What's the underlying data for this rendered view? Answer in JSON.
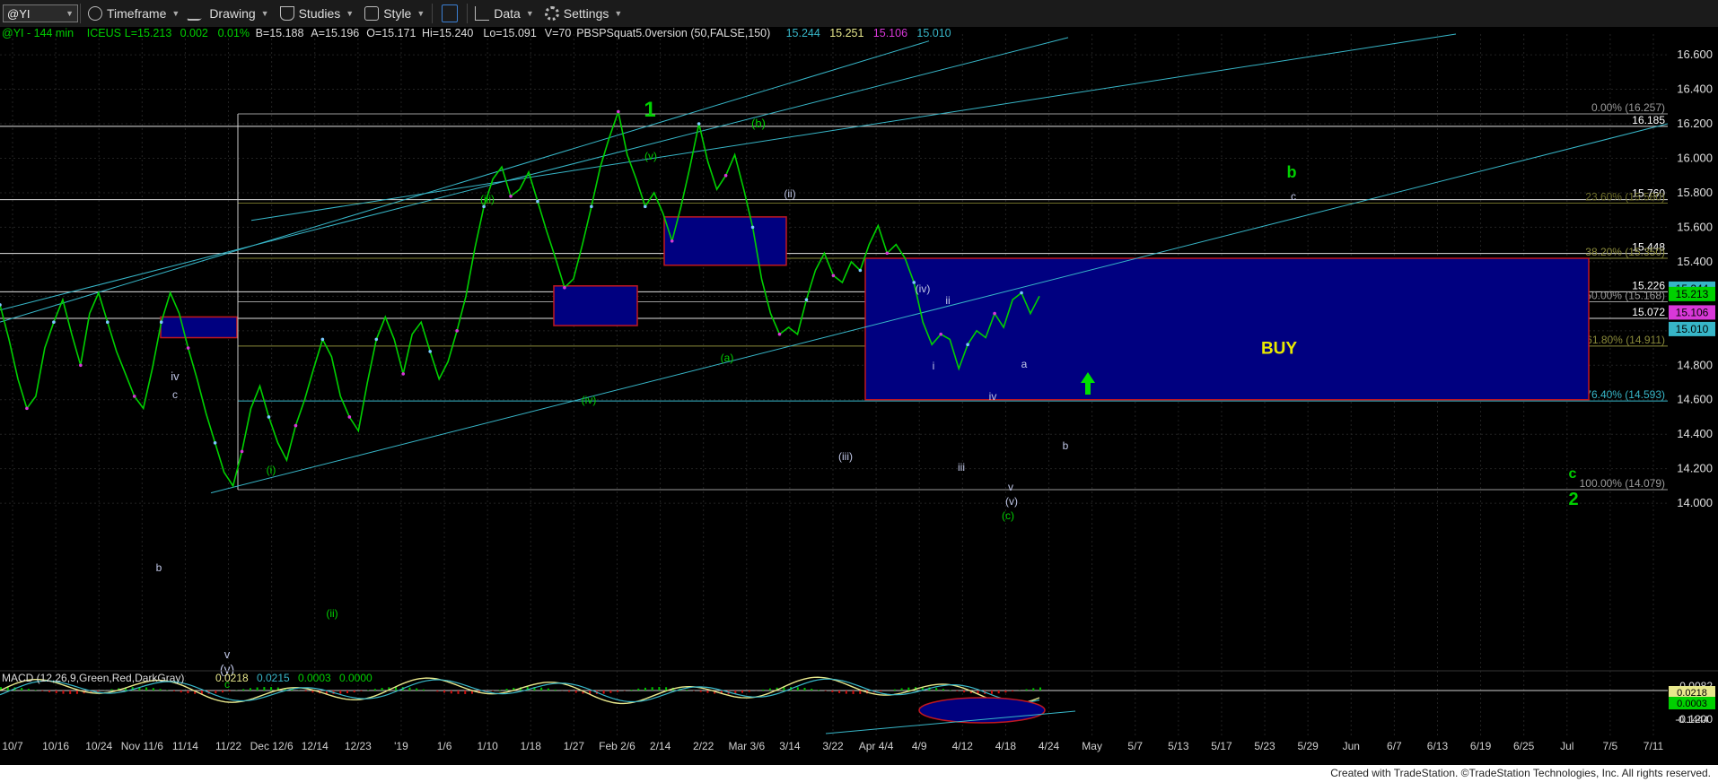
{
  "toolbar": {
    "symbol": "@YI",
    "items": [
      "Timeframe",
      "Drawing",
      "Studies",
      "Style",
      "Data",
      "Settings"
    ]
  },
  "header": {
    "parts": [
      {
        "text": "@YI - 144 min",
        "color": "#00d000"
      },
      {
        "text": "ICEUS",
        "color": "#00d000"
      },
      {
        "text": "L=15.213",
        "color": "#00d000"
      },
      {
        "text": "0.002",
        "color": "#00d000"
      },
      {
        "text": "0.01%",
        "color": "#00d000"
      },
      {
        "text": "B=15.188",
        "color": "#dddddd"
      },
      {
        "text": "A=15.196",
        "color": "#dddddd"
      },
      {
        "text": "O=15.171",
        "color": "#dddddd"
      },
      {
        "text": "Hi=15.240",
        "color": "#dddddd"
      },
      {
        "text": "Lo=15.091",
        "color": "#dddddd"
      },
      {
        "text": "V=70",
        "color": "#dddddd"
      },
      {
        "text": "PBSPSquat5.0version (50,FALSE,150)",
        "color": "#dddddd"
      },
      {
        "text": "15.244",
        "color": "#37b6c8"
      },
      {
        "text": "15.251",
        "color": "#e8e88c"
      },
      {
        "text": "15.106",
        "color": "#d838d8"
      },
      {
        "text": "15.010",
        "color": "#37b6c8"
      }
    ]
  },
  "macd": {
    "label": "MACD (12,26,9,Green,Red,DarkGray)",
    "values": [
      {
        "text": "0.0218",
        "color": "#e8e88c"
      },
      {
        "text": "0.0215",
        "color": "#37b6c8"
      },
      {
        "text": "0.0003",
        "color": "#00d000"
      },
      {
        "text": "0.0000",
        "color": "#00d000"
      }
    ],
    "axis": [
      {
        "y": -0.0082,
        "label": "-0.0082"
      },
      {
        "y": -0.12,
        "label": "-0.1200"
      }
    ],
    "tags": [
      {
        "y": -0.1444,
        "label": "-0.1444",
        "bg": "#000000",
        "fg": "#dddddd"
      },
      {
        "y": 0.0218,
        "label": "0.0218",
        "bg": "#e8e88c",
        "fg": "#000000"
      },
      {
        "y": 0.0003,
        "label": "0.0003",
        "bg": "#00d000",
        "fg": "#000000"
      }
    ]
  },
  "chart_data": {
    "type": "line",
    "ylim": [
      13.85,
      16.72
    ],
    "yticks": [
      14.0,
      14.2,
      14.4,
      14.6,
      14.8,
      15.0,
      15.2,
      15.4,
      15.6,
      15.8,
      16.0,
      16.2,
      16.4,
      16.6
    ],
    "xticks": [
      "10/7",
      "10/16",
      "10/24",
      "Nov 11/6",
      "11/14",
      "11/22",
      "Dec 12/6",
      "12/14",
      "12/23",
      "'19",
      "1/6",
      "1/10",
      "1/18",
      "1/27",
      "Feb 2/6",
      "2/14",
      "2/22",
      "Mar 3/6",
      "3/14",
      "3/22",
      "Apr 4/4",
      "4/9",
      "4/12",
      "4/18",
      "4/24",
      "May",
      "5/7",
      "5/13",
      "5/17",
      "5/23",
      "5/29",
      "Jun",
      "6/7",
      "6/13",
      "6/19",
      "6/25",
      "Jul",
      "7/5",
      "7/11"
    ],
    "price_path": [
      15.15,
      14.95,
      14.72,
      14.55,
      14.62,
      14.9,
      15.05,
      15.18,
      14.98,
      14.8,
      15.1,
      15.22,
      15.05,
      14.88,
      14.75,
      14.62,
      14.55,
      14.78,
      15.05,
      15.22,
      15.1,
      14.9,
      14.72,
      14.52,
      14.35,
      14.18,
      14.1,
      14.3,
      14.55,
      14.68,
      14.5,
      14.35,
      14.25,
      14.45,
      14.6,
      14.78,
      14.95,
      14.85,
      14.62,
      14.5,
      14.42,
      14.7,
      14.95,
      15.08,
      14.95,
      14.75,
      14.98,
      15.05,
      14.88,
      14.72,
      14.82,
      15.0,
      15.2,
      15.48,
      15.72,
      15.88,
      15.95,
      15.78,
      15.82,
      15.92,
      15.75,
      15.58,
      15.42,
      15.25,
      15.3,
      15.5,
      15.72,
      15.95,
      16.12,
      16.27,
      16.02,
      15.88,
      15.72,
      15.8,
      15.68,
      15.52,
      15.72,
      15.95,
      16.2,
      15.98,
      15.82,
      15.9,
      16.02,
      15.82,
      15.6,
      15.3,
      15.1,
      14.98,
      15.02,
      14.98,
      15.18,
      15.35,
      15.45,
      15.32,
      15.28,
      15.4,
      15.35,
      15.5,
      15.61,
      15.45,
      15.5,
      15.42,
      15.28,
      15.05,
      14.92,
      14.98,
      14.95,
      14.78,
      14.92,
      15.0,
      14.96,
      15.1,
      15.02,
      15.18,
      15.22,
      15.1,
      15.2
    ],
    "series": [
      {
        "name": "@YI",
        "color": "#00d000"
      }
    ],
    "right_tags": [
      {
        "y": 15.244,
        "label": "15.244",
        "bg": "#37b6c8",
        "fg": "#000000"
      },
      {
        "y": 15.213,
        "label": "15.213",
        "bg": "#00d000",
        "fg": "#000000"
      },
      {
        "y": 15.106,
        "label": "15.106",
        "bg": "#d838d8",
        "fg": "#000000"
      },
      {
        "y": 15.01,
        "label": "15.010",
        "bg": "#37b6c8",
        "fg": "#000000"
      }
    ],
    "levels": [
      {
        "y": 16.257,
        "label": "0.00% (16.257)",
        "color": "#9a9a9a"
      },
      {
        "y": 16.185,
        "label": "16.185",
        "color": "#e0e0e0"
      },
      {
        "y": 15.76,
        "label": "15.760",
        "color": "#e0e0e0"
      },
      {
        "y": 15.74,
        "label": "23.60% (15.580)",
        "color": "#6f6f2a"
      },
      {
        "y": 15.448,
        "label": "15.448",
        "color": "#e0e0e0"
      },
      {
        "y": 15.42,
        "label": "38.20% (15.350)",
        "color": "#8a8a3a"
      },
      {
        "y": 15.226,
        "label": "15.226",
        "color": "#e0e0e0"
      },
      {
        "y": 15.168,
        "label": "50.00% (15.168)",
        "color": "#9a9a9a"
      },
      {
        "y": 15.072,
        "label": "15.072",
        "color": "#e0e0e0"
      },
      {
        "y": 14.911,
        "label": "61.80% (14.911)",
        "color": "#8a8a3a"
      },
      {
        "y": 14.593,
        "label": "76.40% (14.593)",
        "color": "#37b6c8"
      },
      {
        "y": 14.079,
        "label": "100.00% (14.079)",
        "color": "#9a9a9a"
      }
    ],
    "wave_labels": [
      {
        "label": "1",
        "color": "#00d000"
      },
      {
        "label": "(b)",
        "color": "#00d000"
      },
      {
        "label": "(v)",
        "color": "#00d000"
      },
      {
        "label": "(iii)",
        "color": "#00d000"
      },
      {
        "label": "(ii)",
        "color": "#bfc6e6"
      },
      {
        "label": "(iv)",
        "color": "#00d000"
      },
      {
        "label": "(a)",
        "color": "#00d000"
      },
      {
        "label": "iv",
        "color": "#bfc6e6"
      },
      {
        "label": "c",
        "color": "#bfc6e6"
      },
      {
        "label": "b",
        "color": "#bfc6e6"
      },
      {
        "label": "(i)",
        "color": "#00d000"
      },
      {
        "label": "v",
        "color": "#bfc6e6"
      },
      {
        "label": "(y)",
        "color": "#bfc6e6"
      },
      {
        "label": "c",
        "color": "#00d000"
      },
      {
        "label": "(ii)",
        "color": "#00d000"
      },
      {
        "label": "(iv)",
        "color": "#bfc6e6"
      },
      {
        "label": "ii",
        "color": "#bfc6e6"
      },
      {
        "label": "i",
        "color": "#bfc6e6"
      },
      {
        "label": "(iii)",
        "color": "#bfc6e6"
      },
      {
        "label": "iii",
        "color": "#bfc6e6"
      },
      {
        "label": "iv",
        "color": "#bfc6e6"
      },
      {
        "label": "a",
        "color": "#bfc6e6"
      },
      {
        "label": "b",
        "color": "#bfc6e6"
      },
      {
        "label": "v",
        "color": "#bfc6e6"
      },
      {
        "label": "(v)",
        "color": "#bfc6e6"
      },
      {
        "label": "(c)",
        "color": "#00d000"
      },
      {
        "label": "b",
        "color": "#00d000"
      },
      {
        "label": "c",
        "color": "#bfc6e6"
      },
      {
        "label": "c",
        "color": "#00d000"
      },
      {
        "label": "2",
        "color": "#00d000"
      }
    ],
    "buy_text": "BUY",
    "buy_color": "#e8e800"
  },
  "footer": {
    "text": "Created with TradeStation. ©TradeStation Technologies, Inc. All rights reserved."
  }
}
